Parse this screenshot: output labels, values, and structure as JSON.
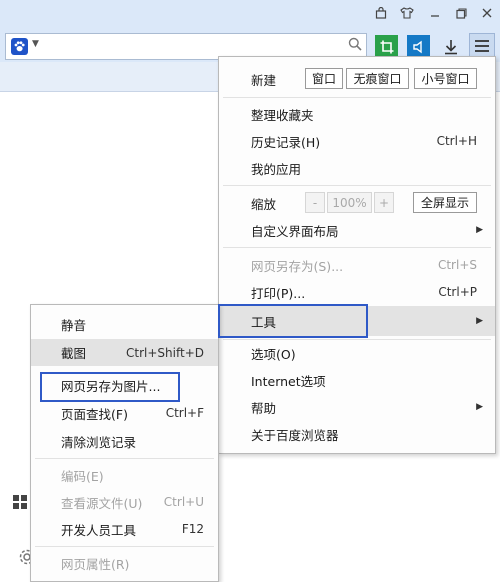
{
  "titlebar": {
    "icons": [
      "bag-icon",
      "shirt-icon",
      "minimize-icon",
      "maximize-icon",
      "close-icon"
    ]
  },
  "addressbar": {
    "value": "",
    "placeholder": ""
  },
  "main_menu": {
    "new_label": "新建",
    "new_window": "窗口",
    "incognito_window": "无痕窗口",
    "small_window": "小号窗口",
    "bookmarks": "整理收藏夹",
    "history": "历史记录(H)",
    "history_sc": "Ctrl+H",
    "my_apps": "我的应用",
    "zoom": "缩放",
    "zoom_minus": "-",
    "zoom_value": "100%",
    "zoom_plus": "+",
    "fullscreen": "全屏显示",
    "customize": "自定义界面布局",
    "save_as": "网页另存为(S)...",
    "save_as_sc": "Ctrl+S",
    "print": "打印(P)...",
    "print_sc": "Ctrl+P",
    "tools": "工具",
    "options": "选项(O)",
    "internet_options": "Internet选项",
    "help": "帮助",
    "about": "关于百度浏览器"
  },
  "sub_menu": {
    "mute": "静音",
    "screenshot": "截图",
    "screenshot_sc": "Ctrl+Shift+D",
    "save_as_image": "网页另存为图片...",
    "find": "页面查找(F)",
    "find_sc": "Ctrl+F",
    "clear_history": "清除浏览记录",
    "encoding": "编码(E)",
    "view_source": "查看源文件(U)",
    "view_source_sc": "Ctrl+U",
    "dev_tools": "开发人员工具",
    "dev_tools_sc": "F12",
    "page_props": "网页属性(R)"
  },
  "colors": {
    "chrome": "#dbe8f9",
    "highlight": "#e3e3e3",
    "focus_outline": "#2f59c7",
    "crop_green": "#2aa14a",
    "volume_blue": "#1579c6"
  }
}
